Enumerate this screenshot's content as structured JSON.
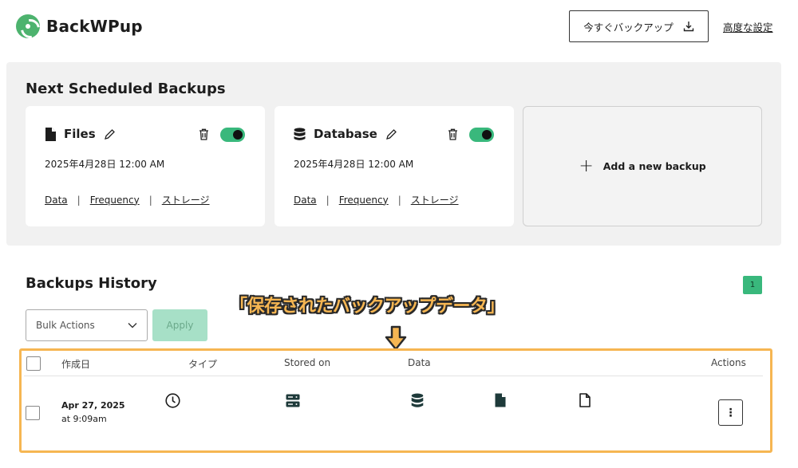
{
  "header": {
    "logo_text": "BackWPup",
    "backup_now_label": "今すぐバックアップ",
    "advanced_settings_label": "高度な設定"
  },
  "scheduled": {
    "title": "Next Scheduled Backups",
    "cards": [
      {
        "title": "Files",
        "date": "2025年4月28日 12:00 AM",
        "enabled": true,
        "links": [
          "Data",
          "Frequency",
          "ストレージ"
        ]
      },
      {
        "title": "Database",
        "date": "2025年4月28日 12:00 AM",
        "enabled": true,
        "links": [
          "Data",
          "Frequency",
          "ストレージ"
        ]
      }
    ],
    "add_label": "Add a new backup"
  },
  "history": {
    "title": "Backups History",
    "page_number": "1",
    "bulk_actions_label": "Bulk Actions",
    "apply_label": "Apply",
    "columns": [
      "作成日",
      "タイプ",
      "Stored on",
      "Data",
      "Actions"
    ],
    "rows": [
      {
        "date": "Apr 27, 2025",
        "time": "at 9:09am",
        "type_icon": "clock-icon",
        "stored_on_icon": "server-icon",
        "data_icons": [
          "database-icon",
          "file-filled-icon",
          "file-outline-icon"
        ]
      }
    ]
  },
  "annotation": {
    "text": "「保存されたバックアップデータ」",
    "color": "#f6b652"
  },
  "colors": {
    "accent": "#39b87c",
    "panel_bg": "#f1f1f1",
    "highlight": "#f6b652"
  }
}
